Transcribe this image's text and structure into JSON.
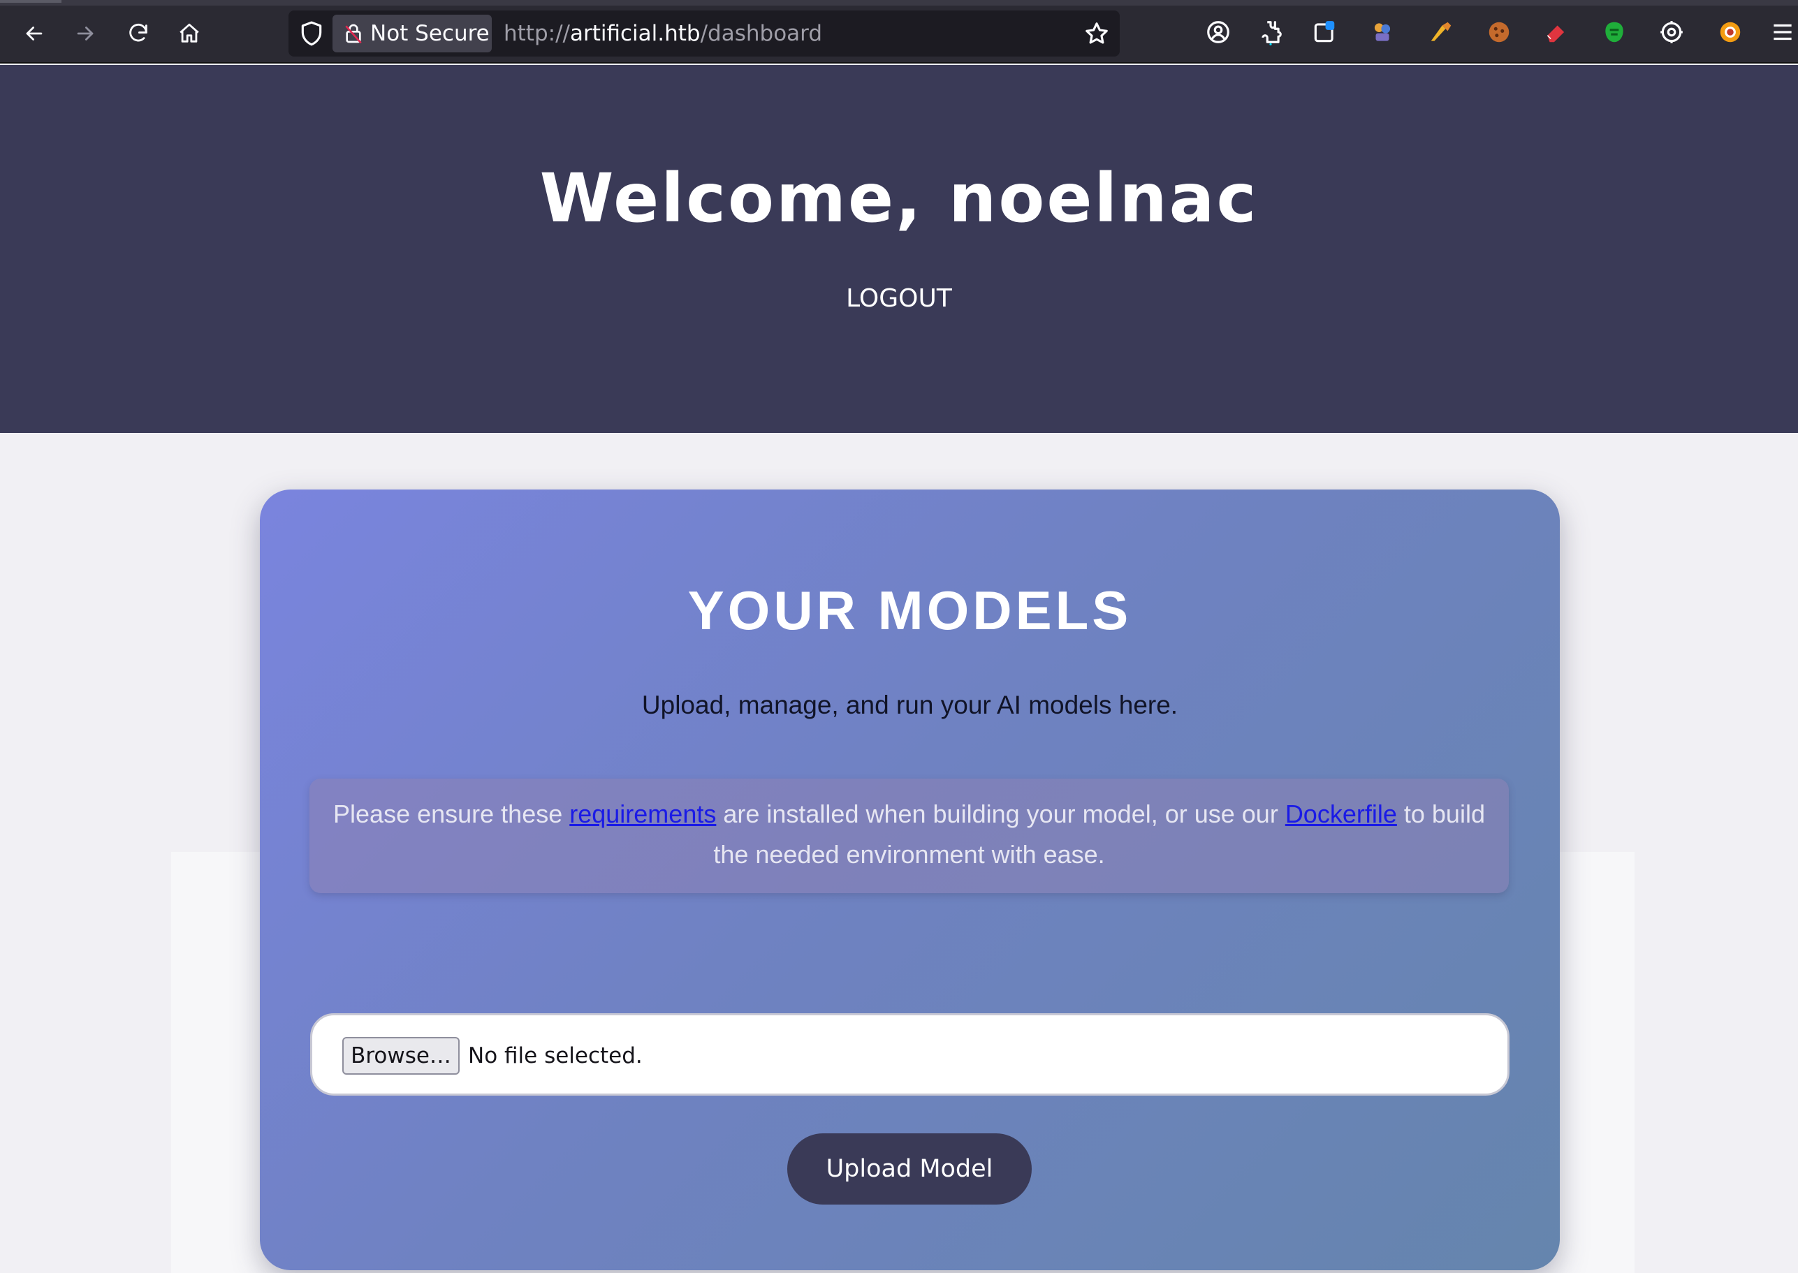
{
  "browser": {
    "security_label": "Not Secure",
    "url_scheme": "http://",
    "url_host": "artificial.htb",
    "url_path": "/dashboard",
    "toolbar_icons": [
      "back-icon",
      "forward-icon",
      "reload-icon",
      "home-icon"
    ],
    "extension_icons": [
      "account-icon",
      "extensions-icon",
      "container-icon",
      "extension-a-icon",
      "extension-b-icon",
      "cookie-icon",
      "eraser-icon",
      "extension-c-icon",
      "settings-icon",
      "extension-d-icon",
      "menu-icon"
    ]
  },
  "header": {
    "welcome": "Welcome, noelnac",
    "logout": "LOGOUT",
    "background": "#3a3a57"
  },
  "card": {
    "title": "YOUR MODELS",
    "subtitle": "Upload, manage, and run your AI models here.",
    "notice_part1": "Please ensure these ",
    "notice_link1": "requirements",
    "notice_part2": " are installed when building your model, or use our ",
    "notice_link2": "Dockerfile",
    "notice_part3": " to build the needed environment with ease.",
    "browse_label": "Browse…",
    "file_status": "No file selected.",
    "upload_label": "Upload Model"
  }
}
